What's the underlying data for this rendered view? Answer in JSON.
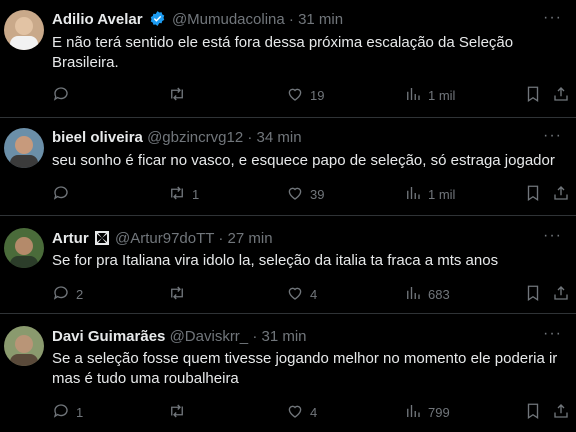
{
  "tweets": [
    {
      "name": "Adilio Avelar",
      "handle": "@Mumudacolina",
      "sep": "·",
      "time": "31 min",
      "text": "E não terá sentido ele está fora dessa próxima escalação da Seleção Brasileira.",
      "replies": "",
      "retweets": "",
      "likes": "19",
      "views": "1 mil",
      "verified": true
    },
    {
      "name": "bieel oliveira",
      "handle": "@gbzincrvg12",
      "sep": "·",
      "time": "34 min",
      "text": "seu sonho é ficar no vasco, e esquece papo de seleção, só estraga jogador",
      "replies": "",
      "retweets": "1",
      "likes": "39",
      "views": "1 mil"
    },
    {
      "name": "Artur",
      "handle": "@Artur97doTT",
      "sep": "·",
      "time": "27 min",
      "text": "Se for pra Italiana vira idolo la, seleção da italia ta fraca a mts anos",
      "replies": "2",
      "retweets": "",
      "likes": "4",
      "views": "683",
      "badge": "maltese-cross"
    },
    {
      "name": "Davi Guimarães",
      "handle": "@Daviskrr_",
      "sep": "·",
      "time": "31 min",
      "text": "Se a seleção fosse quem tivesse jogando melhor no momento ele poderia ir\nmas é tudo uma roubalheira",
      "replies": "1",
      "retweets": "",
      "likes": "4",
      "views": "799"
    }
  ],
  "more_label": "···",
  "colors": {
    "background": "#000000",
    "text": "#e7e9ea",
    "muted": "#71767b",
    "verified": "#1d9bf0",
    "divider": "#2f3336"
  }
}
